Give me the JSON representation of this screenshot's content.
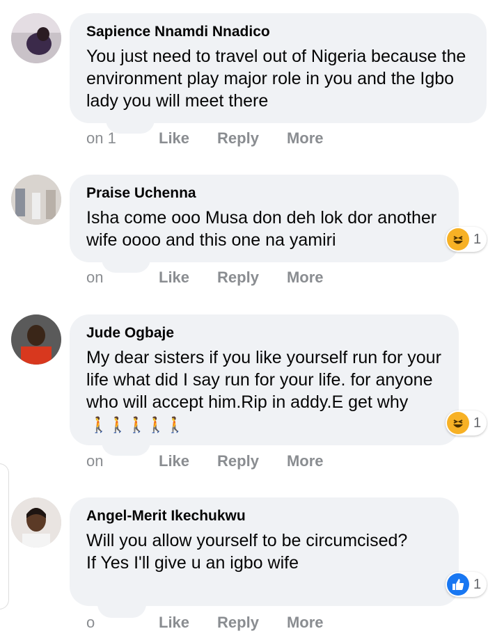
{
  "comments": [
    {
      "author": "Sapience Nnamdi Nnadico",
      "text": "You just need to travel out of Nigeria because the environment play major role in you and the Igbo lady you will meet there",
      "timestamp": "on 1",
      "actions": [
        "Like",
        "Reply",
        "More"
      ],
      "reaction": null
    },
    {
      "author": "Praise Uchenna",
      "text": "Isha come ooo Musa don deh lok dor another wife oooo and this one na yamiri",
      "timestamp": "on",
      "actions": [
        "Like",
        "Reply",
        "More"
      ],
      "reaction": {
        "icon": "laugh-reaction-icon",
        "count": "1"
      }
    },
    {
      "author": "Jude Ogbaje",
      "text": "My dear sisters if you like yourself run for your life what did I say run for your life. for anyone who will accept him.Rip in addy.E get why",
      "timestamp": "on",
      "actions": [
        "Like",
        "Reply",
        "More"
      ],
      "reaction": {
        "icon": "laugh-reaction-icon",
        "count": "1"
      }
    },
    {
      "author": "Angel-Merit Ikechukwu",
      "text": "Will you allow yourself to be circumcised? If Yes I'll give u an igbo wife",
      "timestamp": "o",
      "actions": [
        "Like",
        "Reply",
        "More"
      ],
      "reaction": {
        "icon": "like-reaction-icon",
        "count": "1"
      }
    }
  ],
  "colors": {
    "bubble": "#f0f2f5",
    "action_text": "#8a8d91",
    "like_blue": "#1877f2",
    "laugh_yellow": "#f7b125"
  }
}
